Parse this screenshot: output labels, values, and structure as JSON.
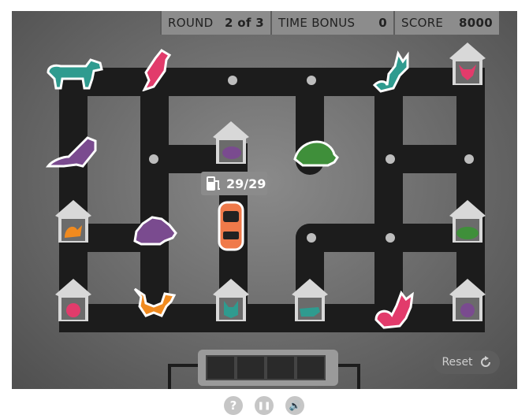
{
  "hud": {
    "round_label": "ROUND",
    "round_value": "2 of 3",
    "time_bonus_label": "TIME BONUS",
    "time_bonus_value": "0",
    "score_label": "SCORE",
    "score_value": "8000"
  },
  "fuel": {
    "icon": "fuel-pump-icon",
    "value": "29/29"
  },
  "reset": {
    "label": "Reset",
    "icon": "refresh-icon"
  },
  "controls": [
    {
      "name": "help-button",
      "glyph": "?"
    },
    {
      "name": "pause-button",
      "glyph": "❚❚"
    },
    {
      "name": "sound-button",
      "glyph": "🔊"
    }
  ],
  "colors": {
    "teal": "#2f9b8f",
    "pink": "#e23b6b",
    "purple": "#7a4b8f",
    "green": "#3f8f3a",
    "orange": "#f08a1f",
    "road": "#1c1c1c",
    "car": "#f07a4a"
  },
  "pieces": [
    {
      "name": "dachshund-teal",
      "color": "teal"
    },
    {
      "name": "parrot-pink",
      "color": "pink"
    },
    {
      "name": "cat-teal",
      "color": "teal"
    },
    {
      "name": "ferret-purple",
      "color": "purple"
    },
    {
      "name": "hedgehog-purple",
      "color": "purple"
    },
    {
      "name": "turtle-green",
      "color": "green"
    },
    {
      "name": "cat-orange",
      "color": "orange"
    },
    {
      "name": "cat-pink",
      "color": "pink"
    }
  ],
  "tray_slots": 4
}
